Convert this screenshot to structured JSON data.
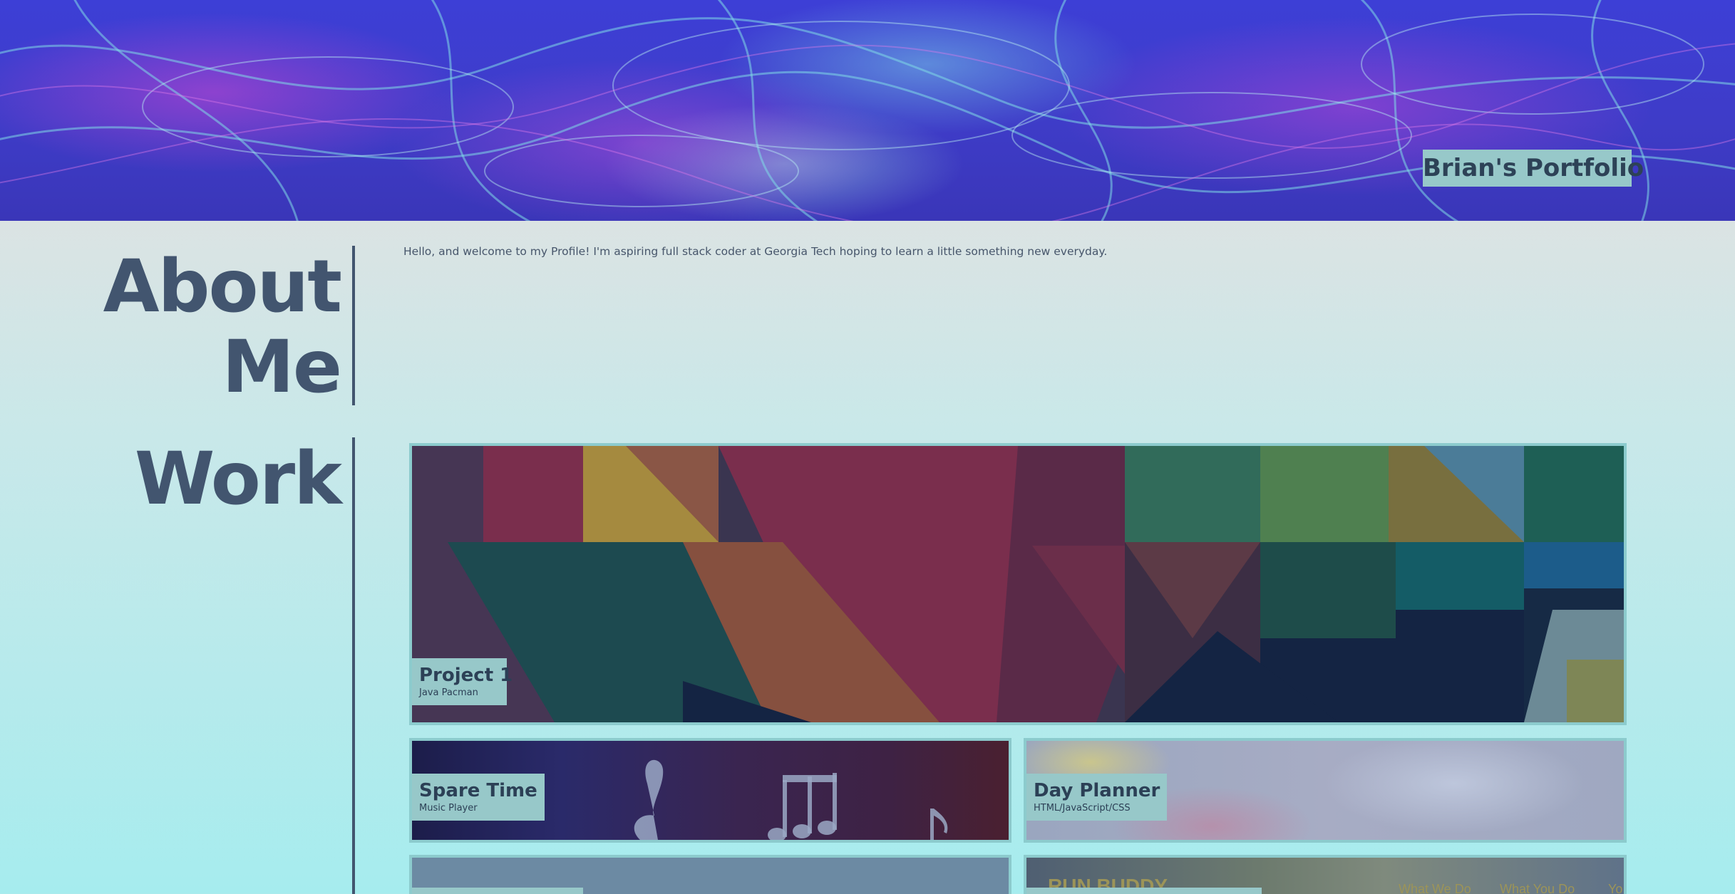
{
  "header": {
    "title": "Brian's Portfolio"
  },
  "about": {
    "heading_line1": "About",
    "heading_line2": "Me",
    "text": "Hello, and welcome to my Profile! I'm aspiring full stack coder at Georgia Tech hoping to learn a little something new everyday."
  },
  "work": {
    "heading": "Work",
    "projects": [
      {
        "name": "Project 1",
        "description": "Java Pacman"
      },
      {
        "name": "Spare Time",
        "description": "Music Player"
      },
      {
        "name": "Day Planner",
        "description": "HTML/JavaScript/CSS"
      }
    ],
    "run_buddy": {
      "title": "RUN BUDDY",
      "nav": [
        "What We Do",
        "What You Do",
        "Yo"
      ]
    }
  },
  "colors": {
    "heading": "#42556f",
    "label_bg": "#97c8c9",
    "tile_border": "#8ccbcd",
    "banner_blue": "#3d3fd6"
  }
}
